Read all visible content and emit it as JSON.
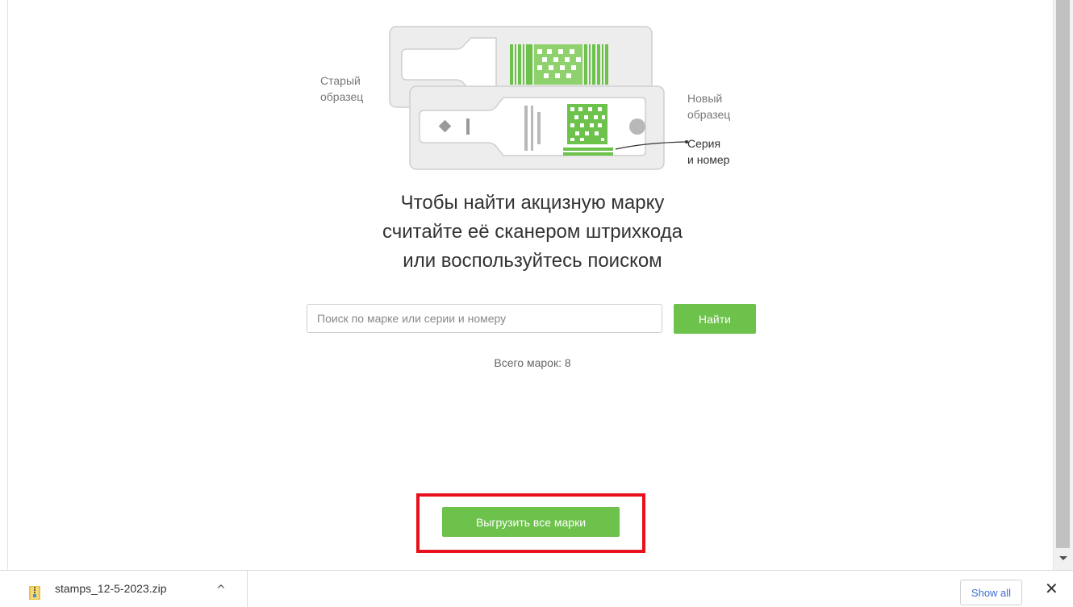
{
  "illustration": {
    "old_label": [
      "Старый",
      "образец"
    ],
    "new_label": [
      "Новый",
      "образец"
    ],
    "series_label": [
      "Серия",
      "и номер"
    ],
    "accent_color": "#6cc24a"
  },
  "heading": {
    "line1": "Чтобы найти акцизную марку",
    "line2": "считайте её сканером штрихкода",
    "line3": "или воспользуйтесь поиском"
  },
  "search": {
    "placeholder": "Поиск по марке или серии и номеру",
    "value": "",
    "button_label": "Найти"
  },
  "total_label": "Всего марок: 8",
  "export": {
    "button_label": "Выгрузить все марки",
    "highlight_color": "#e8101a"
  },
  "download_bar": {
    "file_name": "stamps_12-5-2023.zip",
    "chevron": "^",
    "show_all_label": "Show all",
    "close_label": "✕"
  }
}
